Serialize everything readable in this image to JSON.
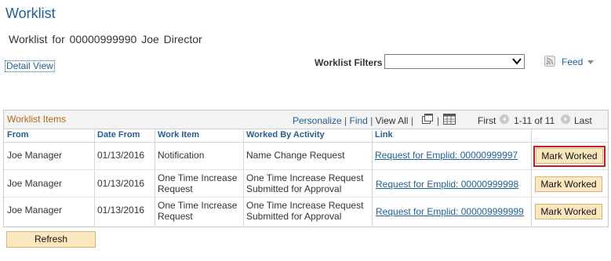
{
  "page": {
    "title": "Worklist",
    "subtitle_prefix": "Worklist for",
    "employee_id": "00000999990",
    "employee_name": "Joe Director",
    "detail_view_label": "Detail View",
    "filters_label": "Worklist Filters",
    "filters_value": "",
    "feed_label": "Feed"
  },
  "grid": {
    "title": "Worklist Items",
    "personalize": "Personalize",
    "find": "Find",
    "view_all": "View All",
    "first": "First",
    "range": "1-11 of 11",
    "last": "Last",
    "columns": [
      "From",
      "Date From",
      "Work Item",
      "Worked By Activity",
      "Link"
    ],
    "rows": [
      {
        "from": "Joe Manager",
        "date": "01/13/2016",
        "item_l1": "Notification",
        "item_l2": "",
        "activity_l1": "Name Change Request",
        "activity_l2": "",
        "link": "Request for Emplid: 00000999997",
        "action": "Mark Worked"
      },
      {
        "from": "Joe Manager",
        "date": "01/13/2016",
        "item_l1": "One Time Increase",
        "item_l2": "Request",
        "activity_l1": "One Time Increase Request",
        "activity_l2": "Submitted for Approval",
        "link": "Request for Emplid: 00000999998",
        "action": "Mark Worked"
      },
      {
        "from": "Joe Manager",
        "date": "01/13/2016",
        "item_l1": "One Time Increase",
        "item_l2": "Request",
        "activity_l1": "One Time Increase Request",
        "activity_l2": "Submitted for Approval",
        "link": "Request for Emplid: 000009999999",
        "action": "Mark Worked"
      }
    ]
  },
  "refresh_label": "Refresh"
}
